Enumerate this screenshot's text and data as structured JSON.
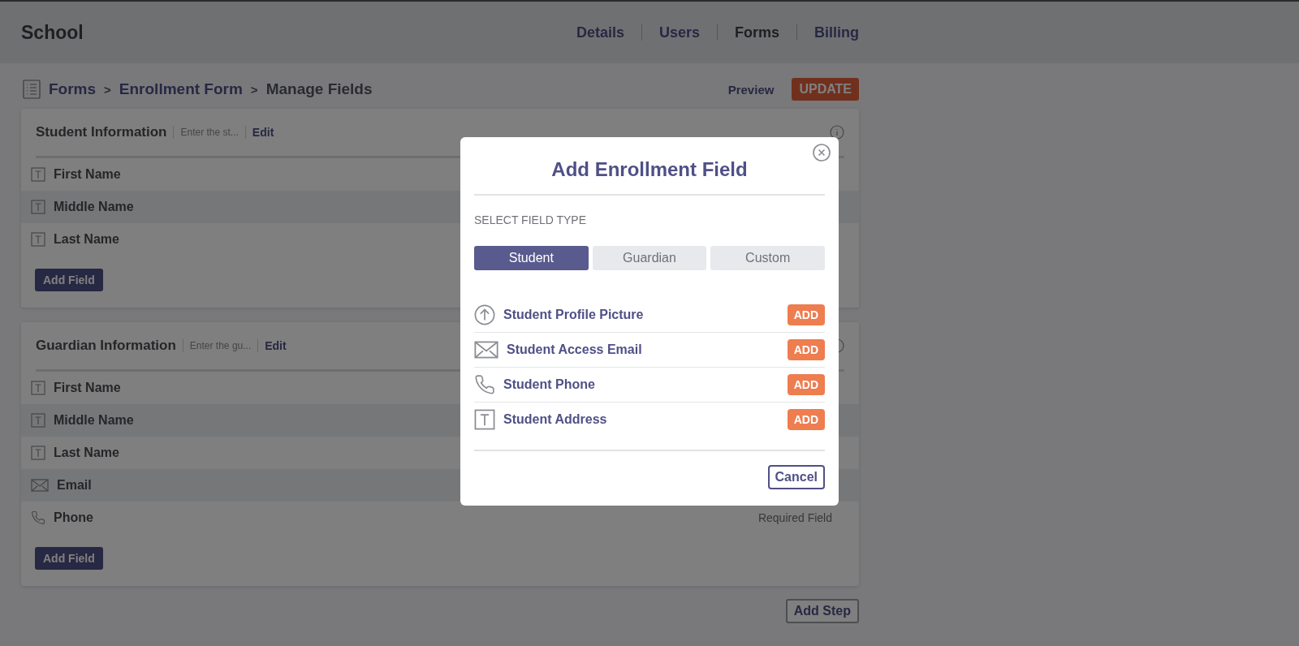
{
  "header": {
    "title": "School",
    "nav": [
      {
        "label": "Details",
        "selected": false
      },
      {
        "label": "Users",
        "selected": false
      },
      {
        "label": "Forms",
        "selected": true
      },
      {
        "label": "Billing",
        "selected": false
      }
    ]
  },
  "breadcrumb": [
    {
      "label": "Forms",
      "kind": "link"
    },
    {
      "separator": ">",
      "label": "Enrollment Form",
      "kind": "link"
    },
    {
      "separator": ">",
      "label": "Manage Fields",
      "kind": "current"
    }
  ],
  "preview": "Preview",
  "update": "UPDATE",
  "sections": [
    {
      "title": "Student Information",
      "description": "Enter the st...",
      "edit": "Edit",
      "add_button": "Add Field",
      "fields": [
        {
          "kind": "text",
          "label": "First Name"
        },
        {
          "kind": "text",
          "label": "Middle Name"
        },
        {
          "kind": "text",
          "label": "Last Name"
        }
      ]
    },
    {
      "title": "Guardian Information",
      "description": "Enter the gu...",
      "edit": "Edit",
      "add_button": "Add Field",
      "fields": [
        {
          "kind": "text",
          "label": "First Name"
        },
        {
          "kind": "text",
          "label": "Middle Name"
        },
        {
          "kind": "text",
          "label": "Last Name"
        },
        {
          "kind": "email",
          "label": "Email"
        },
        {
          "kind": "phone",
          "label": "Phone",
          "note": "Required Field"
        }
      ]
    }
  ],
  "add_step": "Add Step",
  "modal": {
    "title": "Add Enrollment Field",
    "subtitle": "SELECT FIELD TYPE",
    "tabs": [
      {
        "label": "Student",
        "selected": true
      },
      {
        "label": "Guardian",
        "selected": false
      },
      {
        "label": "Custom",
        "selected": false
      }
    ],
    "options": [
      {
        "kind": "upload",
        "label": "Student Profile Picture",
        "button": "ADD"
      },
      {
        "kind": "email",
        "label": "Student Access Email",
        "button": "ADD"
      },
      {
        "kind": "phone",
        "label": "Student Phone",
        "button": "ADD"
      },
      {
        "kind": "text",
        "label": "Student Address",
        "button": "ADD"
      }
    ],
    "cancel": "Cancel"
  }
}
